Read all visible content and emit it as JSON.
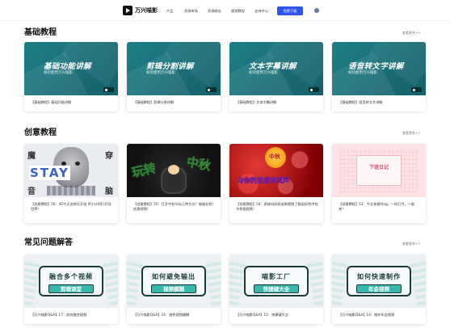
{
  "nav": {
    "logo_text": "万兴喵影",
    "items": [
      "产品",
      "资源市场",
      "资源商店",
      "视频教程",
      "支持中心"
    ],
    "download_label": "免费下载"
  },
  "sections": [
    {
      "title": "基础教程",
      "more": "查看更多>>",
      "cards": [
        {
          "thumb_title": "基础功能讲解",
          "thumb_sub": "如何使用万兴喵影",
          "caption": "【基础教程】基础功能讲解"
        },
        {
          "thumb_title": "剪辑分割讲解",
          "thumb_sub": "如何使用万兴喵影",
          "caption": "【基础教程】剪辑分割讲解"
        },
        {
          "thumb_title": "文本字幕讲解",
          "thumb_sub": "如何使用万兴喵影",
          "caption": "【基础教程】文本字幕讲解"
        },
        {
          "thumb_title": "语音转文字讲解",
          "thumb_sub": "如何使用万兴喵影",
          "caption": "【基础教程】语音转文字讲解"
        }
      ]
    },
    {
      "title": "创意教程",
      "more": "查看更多>>",
      "cards": [
        {
          "thumb_chars": {
            "tl": "魔",
            "tr": "穿",
            "bl": "音",
            "br": "脑",
            "stay": "STAY"
          },
          "caption": "【创意教程】56：40今天去快乐开创 IP小计时行开创世界！"
        },
        {
          "thumb_chars": {
            "a": "玩转",
            "b": "中秋"
          },
          "caption": "【创意教程】55：打开中秋节玩几种方式？喵喵在秋！创意视频！"
        },
        {
          "thumb_chars": {
            "a": "中秋",
            "b": "与你的浪漫说说声"
          },
          "caption": "【创意教程】54：表妹叫妈妈说刷视频了都说好的中秋节祝福视频！"
        },
        {
          "thumb_chars": {
            "a": "下班日记"
          },
          "caption": "【创意教程】53：今天来做Vlog，一网打尽，一起来！"
        }
      ]
    },
    {
      "title": "常见问题解答",
      "more": "查看更多>>",
      "cards": [
        {
          "l1": "融合多个视频",
          "l2": "剪辑课堂",
          "caption": "【万兴喵影Q&A】17：如何融合视频"
        },
        {
          "l1": "如何避免输出",
          "l2": "视频模糊",
          "caption": "【万兴喵影Q&A】16：避免视频模糊"
        },
        {
          "l1": "喵影工厂",
          "l2": "快捷键大全",
          "caption": "【万兴喵影Q&A】15：快捷键大全"
        },
        {
          "l1": "如何快速制作",
          "l2": "年会视频",
          "caption": "【万兴喵影Q&A】14：制作年会视频"
        }
      ]
    }
  ]
}
